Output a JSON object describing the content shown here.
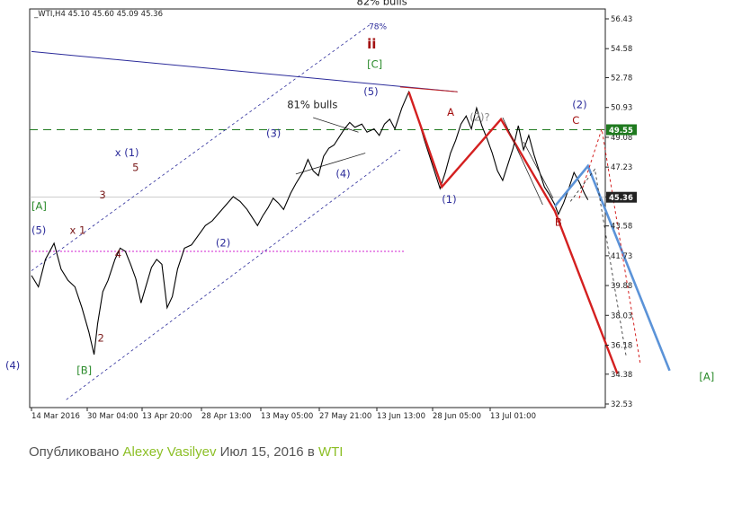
{
  "chart_data": {
    "type": "line",
    "symbol_header": "_WTI,H4  45.10 45.60 45.09 45.36",
    "y_ticks": [
      "56.43",
      "54.58",
      "52.78",
      "50.93",
      "49.08",
      "47.23",
      "45.38",
      "43.58",
      "41.73",
      "39.88",
      "38.03",
      "36.18",
      "34.38",
      "32.53"
    ],
    "y_tick_values": [
      56.43,
      54.58,
      52.78,
      50.93,
      49.08,
      47.23,
      45.38,
      43.58,
      41.73,
      39.88,
      38.03,
      36.18,
      34.38,
      32.53
    ],
    "ylim": [
      32.53,
      56.43
    ],
    "x_ticks": [
      "14 Mar 2016",
      "30 Mar 04:00",
      "13 Apr 20:00",
      "28 Apr 13:00",
      "13 May 05:00",
      "27 May 21:00",
      "13 Jun 13:00",
      "28 Jun 05:00",
      "13 Jul 01:00"
    ],
    "price_markers": [
      {
        "label": "49.55",
        "value": 49.55,
        "color": "#1f7a1f"
      },
      {
        "label": "45.36",
        "value": 45.36,
        "color": "#222222"
      }
    ],
    "levels": [
      {
        "value": 49.55,
        "style": "dashed",
        "color": "#1f7a1f"
      },
      {
        "value": 45.36,
        "style": "solid",
        "color": "#b0b0b0"
      },
      {
        "value": 42.0,
        "style": "dotted",
        "color": "#d020d0"
      }
    ],
    "price_series": [
      [
        0,
        40.5
      ],
      [
        4,
        39.8
      ],
      [
        8,
        41.5
      ],
      [
        13,
        42.5
      ],
      [
        17,
        40.9
      ],
      [
        21,
        40.2
      ],
      [
        25,
        39.8
      ],
      [
        29,
        38.5
      ],
      [
        33,
        37.0
      ],
      [
        36,
        35.6
      ],
      [
        38,
        37.5
      ],
      [
        41,
        39.5
      ],
      [
        44,
        40.2
      ],
      [
        48,
        41.5
      ],
      [
        51,
        42.2
      ],
      [
        54,
        42.0
      ],
      [
        57,
        41.2
      ],
      [
        60,
        40.3
      ],
      [
        63,
        38.8
      ],
      [
        66,
        39.9
      ],
      [
        69,
        41.0
      ],
      [
        72,
        41.5
      ],
      [
        75,
        41.2
      ],
      [
        78,
        38.5
      ],
      [
        81,
        39.2
      ],
      [
        84,
        40.9
      ],
      [
        88,
        42.2
      ],
      [
        92,
        42.4
      ],
      [
        96,
        43.0
      ],
      [
        100,
        43.6
      ],
      [
        104,
        43.9
      ],
      [
        108,
        44.4
      ],
      [
        112,
        44.9
      ],
      [
        116,
        45.4
      ],
      [
        120,
        45.1
      ],
      [
        124,
        44.6
      ],
      [
        127,
        44.1
      ],
      [
        130,
        43.6
      ],
      [
        133,
        44.2
      ],
      [
        136,
        44.7
      ],
      [
        139,
        45.3
      ],
      [
        142,
        45.0
      ],
      [
        145,
        44.6
      ],
      [
        149,
        45.6
      ],
      [
        152,
        46.2
      ],
      [
        156,
        46.9
      ],
      [
        159,
        47.7
      ],
      [
        162,
        47.0
      ],
      [
        165,
        46.7
      ],
      [
        168,
        47.9
      ],
      [
        171,
        48.4
      ],
      [
        174,
        48.6
      ],
      [
        177,
        49.1
      ],
      [
        180,
        49.6
      ],
      [
        183,
        50.0
      ],
      [
        186,
        49.7
      ],
      [
        190,
        49.9
      ],
      [
        193,
        49.4
      ],
      [
        197,
        49.6
      ],
      [
        200,
        49.2
      ],
      [
        203,
        49.9
      ],
      [
        206,
        50.2
      ],
      [
        209,
        49.6
      ],
      [
        213,
        50.9
      ],
      [
        217,
        51.9
      ],
      [
        220,
        50.9
      ],
      [
        223,
        50.0
      ],
      [
        226,
        48.9
      ],
      [
        229,
        47.9
      ],
      [
        232,
        46.9
      ],
      [
        235,
        45.9
      ],
      [
        238,
        46.9
      ],
      [
        241,
        48.1
      ],
      [
        244,
        48.9
      ],
      [
        247,
        49.9
      ],
      [
        250,
        50.4
      ],
      [
        253,
        49.6
      ],
      [
        256,
        50.9
      ],
      [
        259,
        49.8
      ],
      [
        262,
        49.0
      ],
      [
        265,
        48.1
      ],
      [
        268,
        47.0
      ],
      [
        271,
        46.4
      ],
      [
        274,
        47.4
      ],
      [
        277,
        48.4
      ],
      [
        280,
        49.8
      ],
      [
        283,
        48.3
      ],
      [
        286,
        49.2
      ],
      [
        289,
        48.0
      ],
      [
        292,
        47.0
      ],
      [
        295,
        46.0
      ],
      [
        298,
        45.5
      ],
      [
        301,
        44.9
      ],
      [
        303,
        44.3
      ],
      [
        306,
        45.0
      ],
      [
        309,
        45.9
      ],
      [
        312,
        46.9
      ],
      [
        315,
        46.3
      ],
      [
        318,
        45.6
      ],
      [
        320,
        45.2
      ]
    ],
    "annotations": [
      {
        "text": "82% bulls",
        "color": "#222222",
        "x": 187,
        "y": 57.3
      },
      {
        "text": "78%",
        "color": "#2b2b9a",
        "x": 194,
        "y": 55.8
      },
      {
        "text": "ii",
        "color": "#a31010",
        "x": 193,
        "y": 54.6
      },
      {
        "text": "[C]",
        "color": "#2a8a2a",
        "x": 193,
        "y": 53.4
      },
      {
        "text": "(5)",
        "color": "#2b2b9a",
        "x": 191,
        "y": 51.7
      },
      {
        "text": "81% bulls",
        "color": "#222222",
        "x": 147,
        "y": 50.9
      },
      {
        "text": "A",
        "color": "#a31010",
        "x": 239,
        "y": 50.4
      },
      {
        "text": "(2)?",
        "color": "#888888",
        "x": 252,
        "y": 50.1
      },
      {
        "text": "(2)",
        "color": "#2b2b9a",
        "x": 311,
        "y": 50.9
      },
      {
        "text": "C",
        "color": "#a31010",
        "x": 311,
        "y": 49.9
      },
      {
        "text": "(3)",
        "color": "#2b2b9a",
        "x": 135,
        "y": 49.1
      },
      {
        "text": "x (1)",
        "color": "#2b2b9a",
        "x": 48,
        "y": 47.9
      },
      {
        "text": "5",
        "color": "#7a1a1a",
        "x": 58,
        "y": 47.0
      },
      {
        "text": "(4)",
        "color": "#2b2b9a",
        "x": 175,
        "y": 46.6
      },
      {
        "text": "(1)",
        "color": "#2b2b9a",
        "x": 236,
        "y": 45.0
      },
      {
        "text": "3",
        "color": "#7a1a1a",
        "x": 39,
        "y": 45.3
      },
      {
        "text": "[A]",
        "color": "#2a8a2a",
        "x": 0,
        "y": 44.6
      },
      {
        "text": "(5)",
        "color": "#2b2b9a",
        "x": 0,
        "y": 43.1
      },
      {
        "text": "x 1",
        "color": "#7a1a1a",
        "x": 22,
        "y": 43.1
      },
      {
        "text": "B",
        "color": "#a31010",
        "x": 301,
        "y": 43.6
      },
      {
        "text": "(2)",
        "color": "#2b2b9a",
        "x": 106,
        "y": 42.3
      },
      {
        "text": "4",
        "color": "#7a1a1a",
        "x": 48,
        "y": 41.6
      },
      {
        "text": "2",
        "color": "#7a1a1a",
        "x": 38,
        "y": 36.4
      },
      {
        "text": "(4)",
        "color": "#2b2b9a",
        "x": -15,
        "y": 34.7
      },
      {
        "text": "[B]",
        "color": "#2a8a2a",
        "x": 26,
        "y": 34.4
      },
      {
        "text": "[A]",
        "color": "#2a8a2a",
        "x": 384,
        "y": 34.0
      }
    ],
    "wave_lines": [
      {
        "name": "red-wave",
        "color": "#d42020",
        "width": 2.4,
        "dash": "",
        "points": [
          [
            217,
            51.9
          ],
          [
            236,
            46.0
          ],
          [
            270,
            50.2
          ],
          [
            301,
            44.5
          ],
          [
            337,
            34.4
          ]
        ]
      },
      {
        "name": "blue-wave",
        "color": "#5b93d8",
        "width": 2.6,
        "dash": "",
        "points": [
          [
            301,
            44.8
          ],
          [
            320,
            47.3
          ],
          [
            367,
            34.6
          ]
        ]
      },
      {
        "name": "red-dotted-wave",
        "color": "#d42020",
        "width": 1.0,
        "dash": "3,3",
        "points": [
          [
            315,
            45.3
          ],
          [
            328,
            49.6
          ],
          [
            350,
            35.1
          ]
        ]
      },
      {
        "name": "black-dotted-wave",
        "color": "#222222",
        "width": 0.8,
        "dash": "3,3",
        "points": [
          [
            310,
            45.1
          ],
          [
            324,
            47.1
          ],
          [
            342,
            35.5
          ]
        ]
      },
      {
        "name": "black-leg-1",
        "color": "#222222",
        "width": 0.8,
        "dash": "",
        "points": [
          [
            271,
            50.3
          ],
          [
            294,
            44.9
          ]
        ]
      },
      {
        "name": "black-leg-2",
        "color": "#222222",
        "width": 0.8,
        "dash": "",
        "points": [
          [
            283,
            48.8
          ],
          [
            300,
            45.3
          ]
        ]
      }
    ],
    "trend_lines": [
      {
        "name": "channel-top",
        "color": "#2b2b9a",
        "width": 0.8,
        "dash": "3,3",
        "points": [
          [
            0,
            40.8
          ],
          [
            195,
            56.1
          ]
        ]
      },
      {
        "name": "channel-bottom",
        "color": "#2b2b9a",
        "width": 0.8,
        "dash": "3,3",
        "points": [
          [
            20,
            32.8
          ],
          [
            212,
            48.3
          ]
        ]
      },
      {
        "name": "resistance-line",
        "color": "#2b2b9a",
        "width": 1.0,
        "dash": "",
        "points": [
          [
            0,
            54.4
          ],
          [
            245,
            51.9
          ]
        ]
      },
      {
        "name": "red-top-line",
        "color": "#c02020",
        "width": 1.0,
        "dash": "",
        "points": [
          [
            212,
            52.2
          ],
          [
            245,
            51.9
          ]
        ]
      },
      {
        "name": "triangle-top",
        "color": "#222222",
        "width": 0.8,
        "dash": "",
        "points": [
          [
            162,
            50.3
          ],
          [
            188,
            49.4
          ]
        ]
      },
      {
        "name": "triangle-bottom",
        "color": "#222222",
        "width": 0.8,
        "dash": "",
        "points": [
          [
            152,
            46.8
          ],
          [
            192,
            48.1
          ]
        ]
      }
    ]
  },
  "footer": {
    "prefix": "Опубликовано",
    "author": "Alexey Vasilyev",
    "date": "Июл 15, 2016 в",
    "symbol": "WTI"
  }
}
